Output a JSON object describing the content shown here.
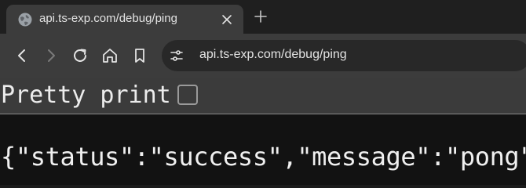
{
  "tab": {
    "title": "api.ts-exp.com/debug/ping"
  },
  "toolbar": {
    "url": "api.ts-exp.com/debug/ping"
  },
  "viewer": {
    "pretty_print_label": "Pretty print",
    "pretty_print_checked": false,
    "body": "{\"status\":\"success\",\"message\":\"pong\"}"
  },
  "colors": {
    "tab_active": "#3c3c3c",
    "tabstrip": "#1f1f1f",
    "omnibox": "#282828",
    "page_background": "#121212"
  },
  "icons": [
    "globe-icon",
    "close-icon",
    "plus-icon",
    "back-icon",
    "forward-icon",
    "reload-icon",
    "home-icon",
    "bookmark-icon",
    "site-info-icon"
  ]
}
